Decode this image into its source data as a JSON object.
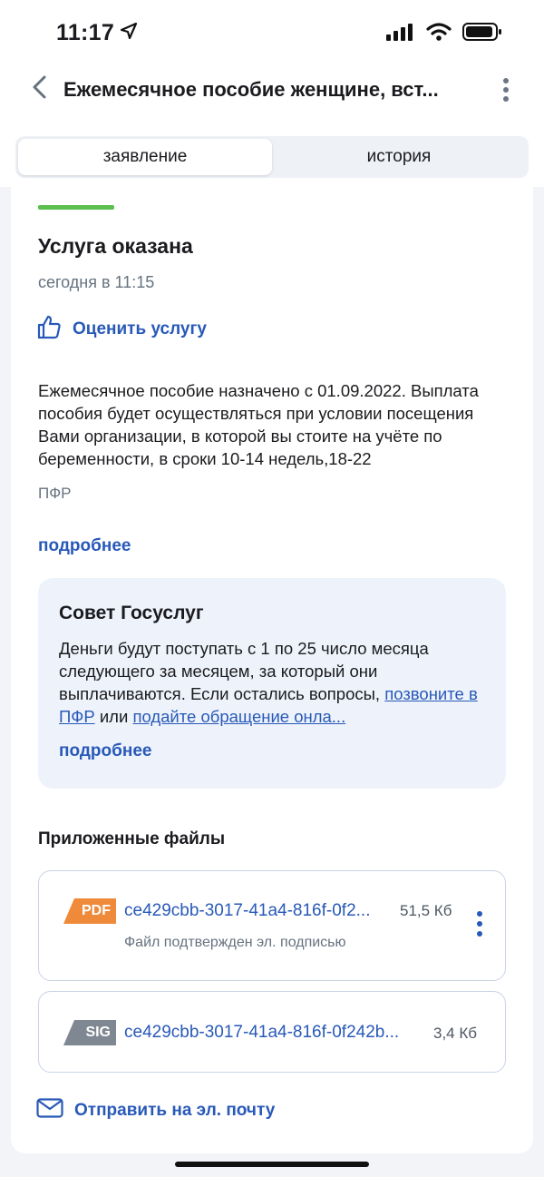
{
  "status_bar": {
    "time": "11:17"
  },
  "header": {
    "title": "Ежемесячное пособие женщине, вст..."
  },
  "tabs": [
    {
      "label": "заявление",
      "active": true
    },
    {
      "label": "история",
      "active": false
    }
  ],
  "status": {
    "title": "Услуга оказана",
    "date": "сегодня в 11:15",
    "rate_label": "Оценить услугу"
  },
  "message": {
    "text": "Ежемесячное пособие назначено с 01.09.2022. Выплата пособия будет осуществляться при условии посещения Вами организации, в которой вы стоите на учёте по беременности, в сроки 10-14 недель,18-22",
    "source": "ПФР",
    "more_label": "подробнее"
  },
  "tip": {
    "title": "Совет Госуслуг",
    "text_before": "Деньги будут поступать с 1 по 25 число месяца следующего за месяцем, за который они выплачиваются. Если остались вопросы, ",
    "link1": "позвоните в ПФР",
    "text_mid": " или ",
    "link2": "подайте обращение онла...",
    "more_label": "подробнее"
  },
  "files": {
    "title": "Приложенные файлы",
    "items": [
      {
        "type": "PDF",
        "name": "ce429cbb-3017-41a4-816f-0f2...",
        "size": "51,5 Кб",
        "note": "Файл подтвержден эл. подписью"
      },
      {
        "type": "SIG",
        "name": "ce429cbb-3017-41a4-816f-0f242b...",
        "size": "3,4 Кб"
      }
    ],
    "email_label": "Отправить на эл. почту"
  },
  "colors": {
    "accent": "#2859b8",
    "success": "#5abf4c",
    "pdf": "#ee8a3a",
    "sig": "#7f8792"
  }
}
